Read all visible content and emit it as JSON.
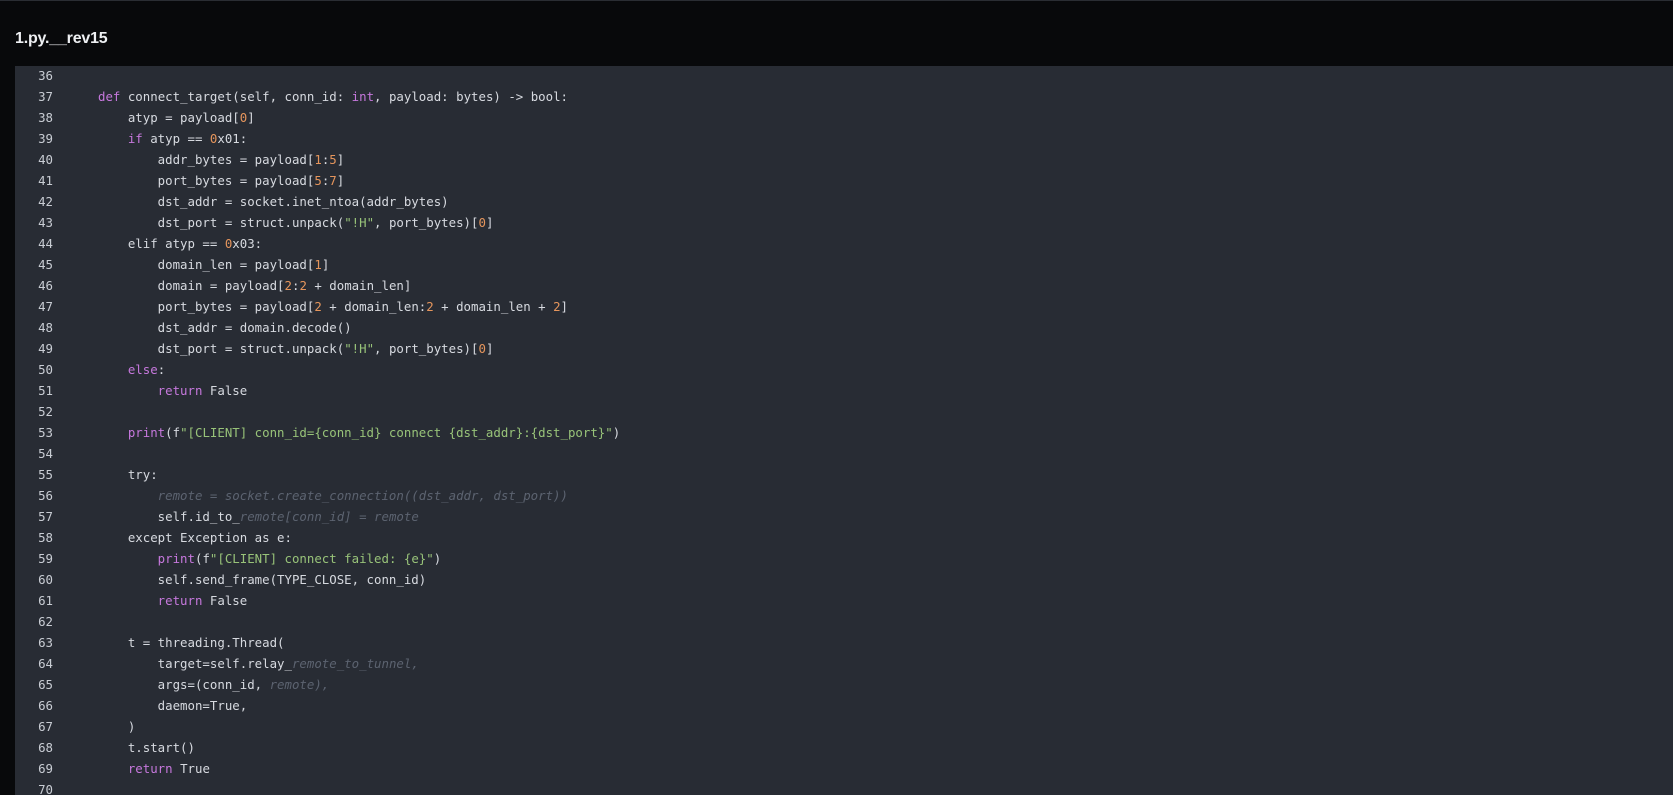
{
  "window": {
    "title": "1.py.__rev15"
  },
  "theme": {
    "background": "#08090b",
    "editor_background": "#282c34",
    "text": "#d7dae0",
    "keyword": "#c678dd",
    "number": "#e5955c",
    "string": "#98c379",
    "comment": "#5c6370"
  },
  "editor": {
    "lines": [
      {
        "n": "36",
        "tokens": []
      },
      {
        "n": "37",
        "tokens": [
          [
            "kw",
            "def"
          ],
          [
            "plain",
            " connect_target(self, conn_id: "
          ],
          [
            "kw",
            "int"
          ],
          [
            "plain",
            ", payload: bytes) -> bool:"
          ]
        ]
      },
      {
        "n": "38",
        "tokens": [
          [
            "plain",
            "    atyp = payload["
          ],
          [
            "num",
            "0"
          ],
          [
            "plain",
            "]"
          ]
        ]
      },
      {
        "n": "39",
        "tokens": [
          [
            "kw",
            "    if"
          ],
          [
            "plain",
            " atyp == "
          ],
          [
            "num",
            "0"
          ],
          [
            "plain",
            "x01:"
          ]
        ]
      },
      {
        "n": "40",
        "tokens": [
          [
            "plain",
            "        addr_bytes = payload["
          ],
          [
            "num",
            "1"
          ],
          [
            "plain",
            ":"
          ],
          [
            "num",
            "5"
          ],
          [
            "plain",
            "]"
          ]
        ]
      },
      {
        "n": "41",
        "tokens": [
          [
            "plain",
            "        port_bytes = payload["
          ],
          [
            "num",
            "5"
          ],
          [
            "plain",
            ":"
          ],
          [
            "num",
            "7"
          ],
          [
            "plain",
            "]"
          ]
        ]
      },
      {
        "n": "42",
        "tokens": [
          [
            "plain",
            "        dst_addr = socket.inet_ntoa(addr_bytes)"
          ]
        ]
      },
      {
        "n": "43",
        "tokens": [
          [
            "plain",
            "        dst_port = struct.unpack("
          ],
          [
            "str",
            "\"!H\""
          ],
          [
            "plain",
            ", port_bytes)["
          ],
          [
            "num",
            "0"
          ],
          [
            "plain",
            "]"
          ]
        ]
      },
      {
        "n": "44",
        "tokens": [
          [
            "plain",
            "    elif atyp == "
          ],
          [
            "num",
            "0"
          ],
          [
            "plain",
            "x03:"
          ]
        ]
      },
      {
        "n": "45",
        "tokens": [
          [
            "plain",
            "        domain_len = payload["
          ],
          [
            "num",
            "1"
          ],
          [
            "plain",
            "]"
          ]
        ]
      },
      {
        "n": "46",
        "tokens": [
          [
            "plain",
            "        domain = payload["
          ],
          [
            "num",
            "2"
          ],
          [
            "plain",
            ":"
          ],
          [
            "num",
            "2"
          ],
          [
            "plain",
            " + domain_len]"
          ]
        ]
      },
      {
        "n": "47",
        "tokens": [
          [
            "plain",
            "        port_bytes = payload["
          ],
          [
            "num",
            "2"
          ],
          [
            "plain",
            " + domain_len:"
          ],
          [
            "num",
            "2"
          ],
          [
            "plain",
            " + domain_len + "
          ],
          [
            "num",
            "2"
          ],
          [
            "plain",
            "]"
          ]
        ]
      },
      {
        "n": "48",
        "tokens": [
          [
            "plain",
            "        dst_addr = domain.decode()"
          ]
        ]
      },
      {
        "n": "49",
        "tokens": [
          [
            "plain",
            "        dst_port = struct.unpack("
          ],
          [
            "str",
            "\"!H\""
          ],
          [
            "plain",
            ", port_bytes)["
          ],
          [
            "num",
            "0"
          ],
          [
            "plain",
            "]"
          ]
        ]
      },
      {
        "n": "50",
        "tokens": [
          [
            "kw",
            "    else"
          ],
          [
            "plain",
            ":"
          ]
        ]
      },
      {
        "n": "51",
        "tokens": [
          [
            "kw",
            "        return"
          ],
          [
            "plain",
            " False"
          ]
        ]
      },
      {
        "n": "52",
        "tokens": []
      },
      {
        "n": "53",
        "tokens": [
          [
            "kw",
            "    print"
          ],
          [
            "plain",
            "(f"
          ],
          [
            "str",
            "\"[CLIENT] conn_id={conn_id} connect {dst_addr}:{dst_port}\""
          ],
          [
            "plain",
            ")"
          ]
        ]
      },
      {
        "n": "54",
        "tokens": []
      },
      {
        "n": "55",
        "tokens": [
          [
            "plain",
            "    try:"
          ]
        ]
      },
      {
        "n": "56",
        "tokens": [
          [
            "comment",
            "        remote = socket.create_connection((dst_addr, dst_port))"
          ]
        ]
      },
      {
        "n": "57",
        "tokens": [
          [
            "plain",
            "        self.id_to_"
          ],
          [
            "comment",
            "remote[conn_id] = remote"
          ]
        ]
      },
      {
        "n": "58",
        "tokens": [
          [
            "plain",
            "    except Exception as e:"
          ]
        ]
      },
      {
        "n": "59",
        "tokens": [
          [
            "kw",
            "        print"
          ],
          [
            "plain",
            "(f"
          ],
          [
            "str",
            "\"[CLIENT] connect failed: {e}\""
          ],
          [
            "plain",
            ")"
          ]
        ]
      },
      {
        "n": "60",
        "tokens": [
          [
            "plain",
            "        self.send_frame(TYPE_CLOSE, conn_id)"
          ]
        ]
      },
      {
        "n": "61",
        "tokens": [
          [
            "kw",
            "        return"
          ],
          [
            "plain",
            " False"
          ]
        ]
      },
      {
        "n": "62",
        "tokens": []
      },
      {
        "n": "63",
        "tokens": [
          [
            "plain",
            "    t = threading.Thread("
          ]
        ]
      },
      {
        "n": "64",
        "tokens": [
          [
            "plain",
            "        target=self.relay_"
          ],
          [
            "comment",
            "remote_to_tunnel,"
          ]
        ]
      },
      {
        "n": "65",
        "tokens": [
          [
            "plain",
            "        args=(conn_id, "
          ],
          [
            "comment",
            "remote),"
          ]
        ]
      },
      {
        "n": "66",
        "tokens": [
          [
            "plain",
            "        daemon=True,"
          ]
        ]
      },
      {
        "n": "67",
        "tokens": [
          [
            "plain",
            "    )"
          ]
        ]
      },
      {
        "n": "68",
        "tokens": [
          [
            "plain",
            "    t.start()"
          ]
        ]
      },
      {
        "n": "69",
        "tokens": [
          [
            "kw",
            "    return"
          ],
          [
            "plain",
            " True"
          ]
        ]
      },
      {
        "n": "70",
        "tokens": []
      }
    ]
  }
}
